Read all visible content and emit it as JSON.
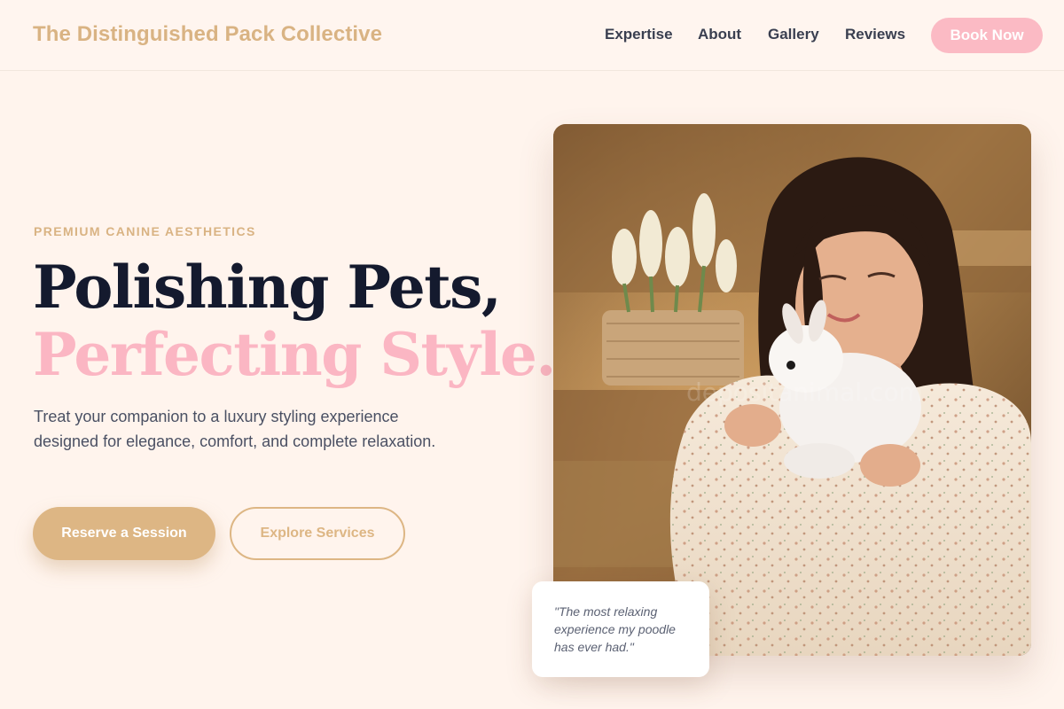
{
  "header": {
    "brand": "The Distinguished Pack Collective",
    "nav": [
      "Expertise",
      "About",
      "Gallery",
      "Reviews"
    ],
    "cta_label": "Book Now"
  },
  "hero": {
    "eyebrow": "PREMIUM CANINE AESTHETICS",
    "headline_line1": "Polishing Pets,",
    "headline_line2": "Perfecting Style.",
    "lede": "Treat your companion to a luxury styling experience designed for elegance, comfort, and complete relaxation.",
    "primary_button": "Reserve a Session",
    "secondary_button": "Explore Services",
    "image_watermark": "depositphotos-style watermark (illegible)"
  },
  "testimonial": {
    "quote": "\"The most relaxing experience my poodle has ever had.\""
  },
  "colors": {
    "background": "#fff4ed",
    "accent_gold": "#ddb684",
    "accent_pink": "#fbb6c3",
    "heading_navy": "#141a2e",
    "body_text": "#4a5063"
  }
}
